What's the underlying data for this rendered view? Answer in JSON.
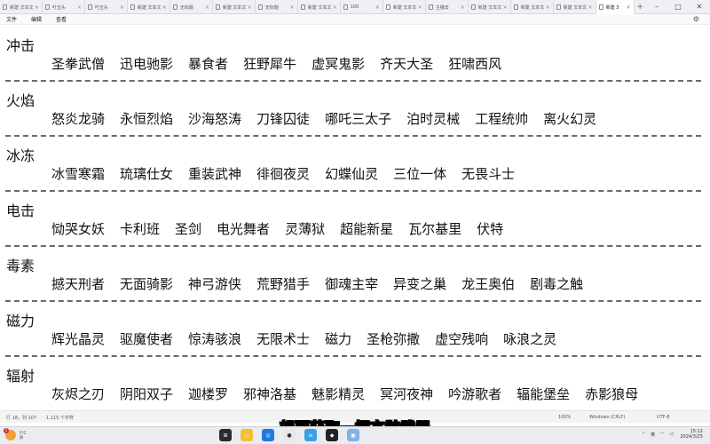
{
  "tabs": [
    {
      "label": "新建 文本文"
    },
    {
      "label": "叮五头"
    },
    {
      "label": "叮五头"
    },
    {
      "label": "新建 文本文"
    },
    {
      "label": "无标题"
    },
    {
      "label": "新建 文本文"
    },
    {
      "label": "无标题"
    },
    {
      "label": "新建 文本文"
    },
    {
      "label": "100"
    },
    {
      "label": "新建 文本文"
    },
    {
      "label": "主播去"
    },
    {
      "label": "新建 文本文"
    },
    {
      "label": "新建 文本文"
    },
    {
      "label": "新建 文本文"
    },
    {
      "label": "新建 3"
    }
  ],
  "menu": {
    "file": "文件",
    "edit": "编辑",
    "view": "查看"
  },
  "categories": [
    {
      "name": "冲击",
      "items": [
        "圣拳武僧",
        "迅电驰影",
        "暴食者",
        "狂野犀牛",
        "虚冥鬼影",
        "齐天大圣",
        "狂啸西风"
      ]
    },
    {
      "name": "火焰",
      "items": [
        "怒炎龙骑",
        "永恒烈焰",
        "沙海怒涛",
        "刀锋囚徒",
        "哪吒三太子",
        "泊时灵械",
        "工程统帅",
        "离火幻灵"
      ]
    },
    {
      "name": "冰冻",
      "items": [
        "冰雪寒霜",
        "琉璃仕女",
        "重装武神",
        "徘徊夜灵",
        "幻蝶仙灵",
        "三位一体",
        "无畏斗士"
      ]
    },
    {
      "name": "电击",
      "items": [
        "恸哭女妖",
        "卡利班",
        "圣剑",
        "电光舞者",
        "灵薄狱",
        "超能新星",
        "瓦尔基里",
        "伏特"
      ]
    },
    {
      "name": "毒素",
      "items": [
        "撼天刑者",
        "无面骑影",
        "神弓游侠",
        "荒野猎手",
        "御魂主宰",
        "异变之巢",
        "龙王奥伯",
        "剧毒之触"
      ]
    },
    {
      "name": "磁力",
      "items": [
        "辉光晶灵",
        "驱魔使者",
        "惊涛骇浪",
        "无限术士",
        "磁力",
        "圣枪弥撒",
        "虚空残响",
        "咏浪之灵"
      ]
    },
    {
      "name": "辐射",
      "items": [
        "灰烬之刃",
        "阴阳双子",
        "迦楼罗",
        "邪神洛基",
        "魅影精灵",
        "冥河夜神",
        "吟游歌者",
        "辐能堡垒",
        "赤影狼母"
      ]
    }
  ],
  "status": {
    "position": "行 18，列 107",
    "chars": "1,115 个字符",
    "zoom": "100%",
    "eol": "Windows (CRLF)",
    "encoding": "UTF-8"
  },
  "subtitle": "想要获取一把玄骸武器",
  "taskbar": {
    "temp": "5°C",
    "weather": "阴",
    "badge": "1",
    "lang": "英",
    "time": "15:12",
    "date": "2024/3/25"
  }
}
